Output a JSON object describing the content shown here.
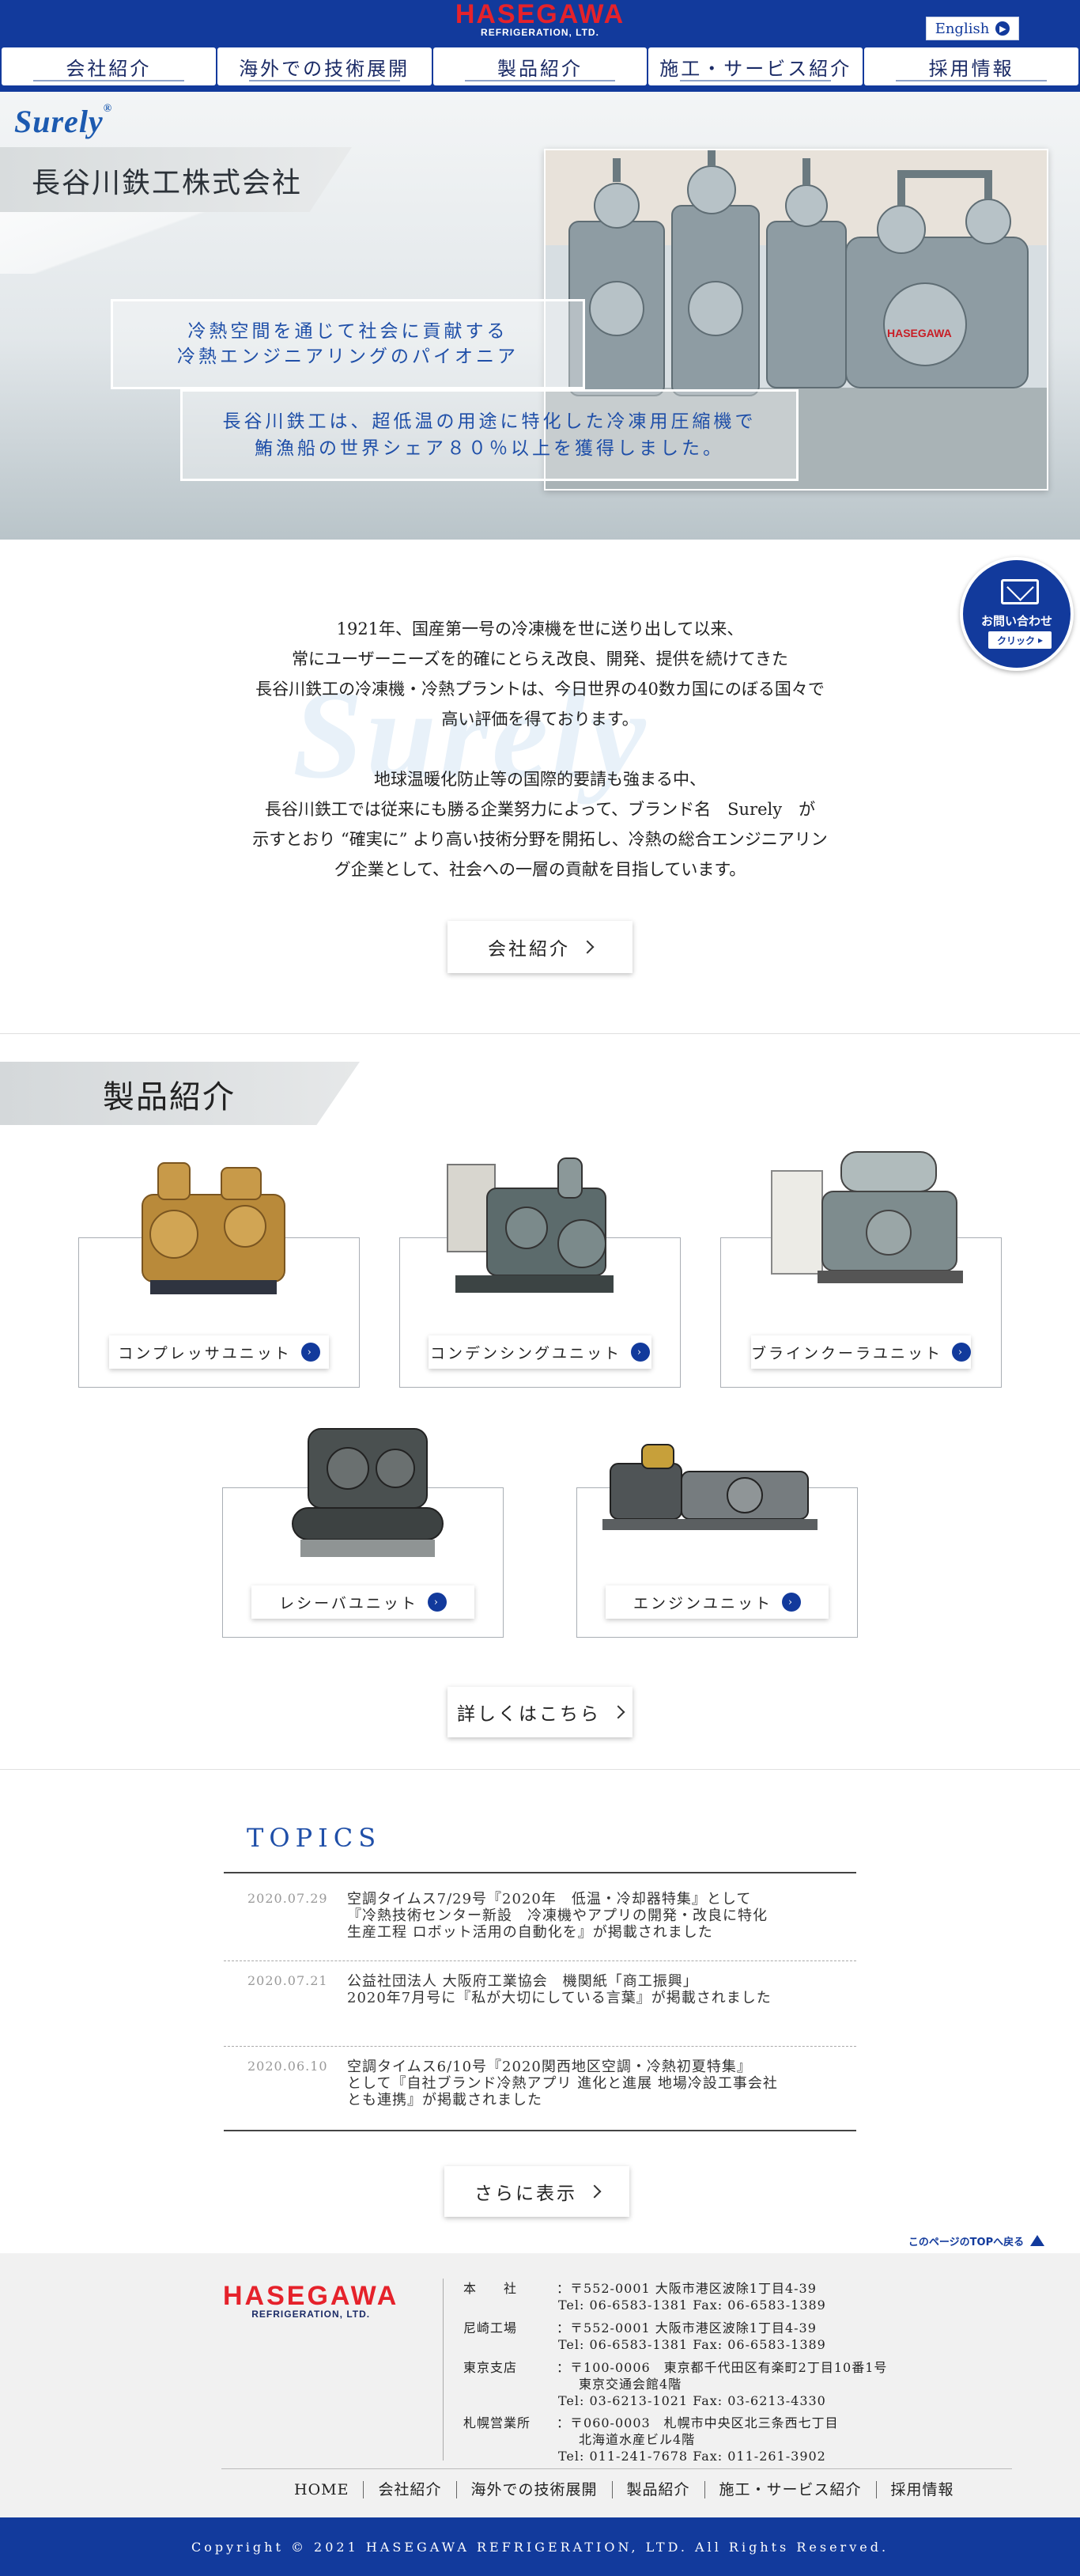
{
  "header": {
    "logo_main": "HASEGAWA",
    "logo_sub": "REFRIGERATION, LTD.",
    "lang_label": "English"
  },
  "nav": {
    "items": [
      "会社紹介",
      "海外での技術展開",
      "製品紹介",
      "施工・サービス紹介",
      "採用情報"
    ]
  },
  "hero": {
    "brand": "Surely",
    "brand_mark": "®",
    "company_name": "長谷川鉄工株式会社",
    "catch_line1": "冷熱空間を通じて社会に貢献する",
    "catch_line2": "冷熱エンジニアリングのパイオニア",
    "catch_line3": "長谷川鉄工は、超低温の用途に特化した冷凍用圧縮機で",
    "catch_line4": "鮪漁船の世界シェア８０％以上を獲得しました。"
  },
  "contact": {
    "label": "お問い合わせ",
    "click": "クリック"
  },
  "intro": {
    "watermark": "Surely",
    "para1": [
      "1921年、国産第一号の冷凍機を世に送り出して以来、",
      "常にユーザーニーズを的確にとらえ改良、開発、提供を続けてきた",
      "長谷川鉄工の冷凍機・冷熱プラントは、今日世界の40数カ国にのぼる国々で",
      "高い評価を得ております。"
    ],
    "para2": [
      "地球温暖化防止等の国際的要請も強まる中、",
      "長谷川鉄工では従来にも勝る企業努力によって、ブランド名　Surely　が",
      "示すとおり “確実に” より高い技術分野を開拓し、冷熱の総合エンジニアリン",
      "グ企業として、社会への一層の貢献を目指しています。"
    ],
    "button": "会社紹介"
  },
  "products": {
    "title": "製品紹介",
    "items": [
      {
        "label": "コンプレッサユニット"
      },
      {
        "label": "コンデンシングユニット"
      },
      {
        "label": "ブラインクーラユニット"
      },
      {
        "label": "レシーバユニット"
      },
      {
        "label": "エンジンユニット"
      }
    ],
    "more_button": "詳しくはこちら"
  },
  "topics": {
    "title": "TOPICS",
    "items": [
      {
        "date": "2020.07.29",
        "lines": [
          "空調タイムス7/29号『2020年　低温・冷却器特集』として",
          "『冷熱技術センター新設　冷凍機やアプリの開発・改良に特化",
          "生産工程 ロボット活用の自動化を』が掲載されました"
        ]
      },
      {
        "date": "2020.07.21",
        "lines": [
          "公益社団法人 大阪府工業協会　機関紙「商工振興」",
          "2020年7月号に『私が大切にしている言葉』が掲載されました"
        ]
      },
      {
        "date": "2020.06.10",
        "lines": [
          "空調タイムス6/10号『2020関西地区空調・冷熱初夏特集』",
          "として『自社ブランド冷熱アプリ 進化と進展 地場冷設工事会社",
          "とも連携』が掲載されました"
        ]
      }
    ],
    "more_button": "さらに表示"
  },
  "to_top": "このページのTOPへ戻る",
  "footer": {
    "logo_main": "HASEGAWA",
    "logo_sub": "REFRIGERATION, LTD.",
    "offices": [
      {
        "label": "本　　社",
        "lines": [
          "〒552-0001 大阪市港区波除1丁目4-39",
          "Tel: 06-6583-1381 Fax: 06-6583-1389"
        ]
      },
      {
        "label": "尼崎工場",
        "lines": [
          "〒552-0001 大阪市港区波除1丁目4-39",
          "Tel: 06-6583-1381 Fax: 06-6583-1389"
        ]
      },
      {
        "label": "東京支店",
        "lines": [
          "〒100-0006　東京都千代田区有楽町2丁目10番1号",
          "東京交通会館4階",
          "Tel: 03-6213-1021 Fax: 03-6213-4330"
        ]
      },
      {
        "label": "札幌営業所",
        "lines": [
          "〒060-0003　札幌市中央区北三条西七丁目",
          "北海道水産ビル4階",
          "Tel: 011-241-7678 Fax: 011-261-3902"
        ]
      }
    ],
    "nav": [
      "HOME",
      "会社紹介",
      "海外での技術展開",
      "製品紹介",
      "施工・サービス紹介",
      "採用情報"
    ],
    "copyright": "Copyright © 2021 HASEGAWA REFRIGERATION, LTD. All Rights Reserved."
  },
  "colors": {
    "brand_blue": "#123a9c",
    "logo_red": "#e5222b",
    "catch_blue": "#1f4fa8"
  }
}
